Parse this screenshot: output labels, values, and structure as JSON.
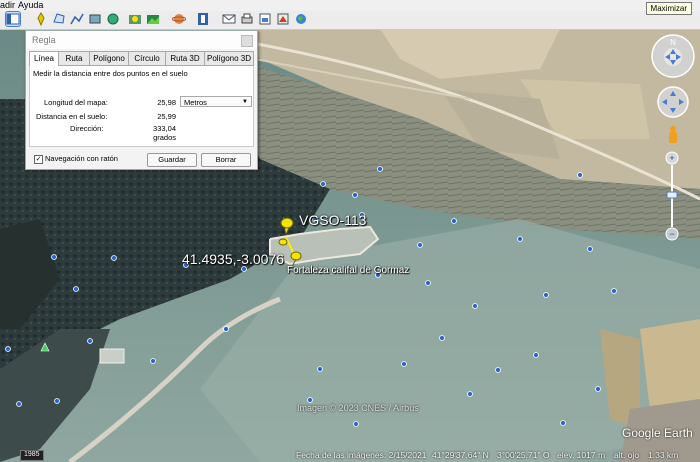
{
  "menu": {
    "items": [
      "adir",
      "Ayuda"
    ]
  },
  "tooltip": "Maximizar",
  "toolbar": {
    "buttons": [
      "sidebar-toggle-icon",
      "placemark-icon",
      "polygon-icon",
      "path-icon",
      "overlay-icon",
      "tour-icon",
      "history-icon",
      "sunlight-icon",
      "planets-icon",
      "ruler-icon",
      "email-icon",
      "print-icon",
      "save-image-icon",
      "maps-icon",
      "earth-icon"
    ]
  },
  "dialog": {
    "title": "Regla",
    "tabs": [
      "Línea",
      "Ruta",
      "Polígono",
      "Círculo",
      "Ruta 3D",
      "Polígono 3D"
    ],
    "active_tab": "Línea",
    "description": "Medir la distancia entre dos puntos en el suelo",
    "map_length_label": "Longitud del mapa:",
    "map_length_value": "25,98",
    "unit": "Metros",
    "ground_length_label": "Distancia en el suelo:",
    "ground_length_value": "25,99",
    "heading_label": "Dirección:",
    "heading_value": "333,04 grados",
    "mouse_nav_label": "Navegación con ratón",
    "mouse_nav_checked": true,
    "save_label": "Guardar",
    "clear_label": "Borrar"
  },
  "map": {
    "placemark_vgso": "VGSO-113",
    "placemark_coords": "41.4935,-3.0076",
    "placemark_fortress": "Fortaleza califal de Gormaz",
    "copyright": "Imagen © 2023 CNES / Airbus",
    "logo": "Google Earth"
  },
  "status": {
    "year": "1985",
    "imagery_date": "Fecha de las imágenes: 2/15/2021",
    "lat": "41°29'37.64\" N",
    "lon": "3°00'25.71\" O",
    "elevation": "elev. 1017 m",
    "eye_alt": "alt. ojo",
    "eye_alt_value": "1.33 km"
  },
  "colors": {
    "path": "#ffee00",
    "pin": "#f5e400",
    "accent": "#4a7bd0"
  }
}
